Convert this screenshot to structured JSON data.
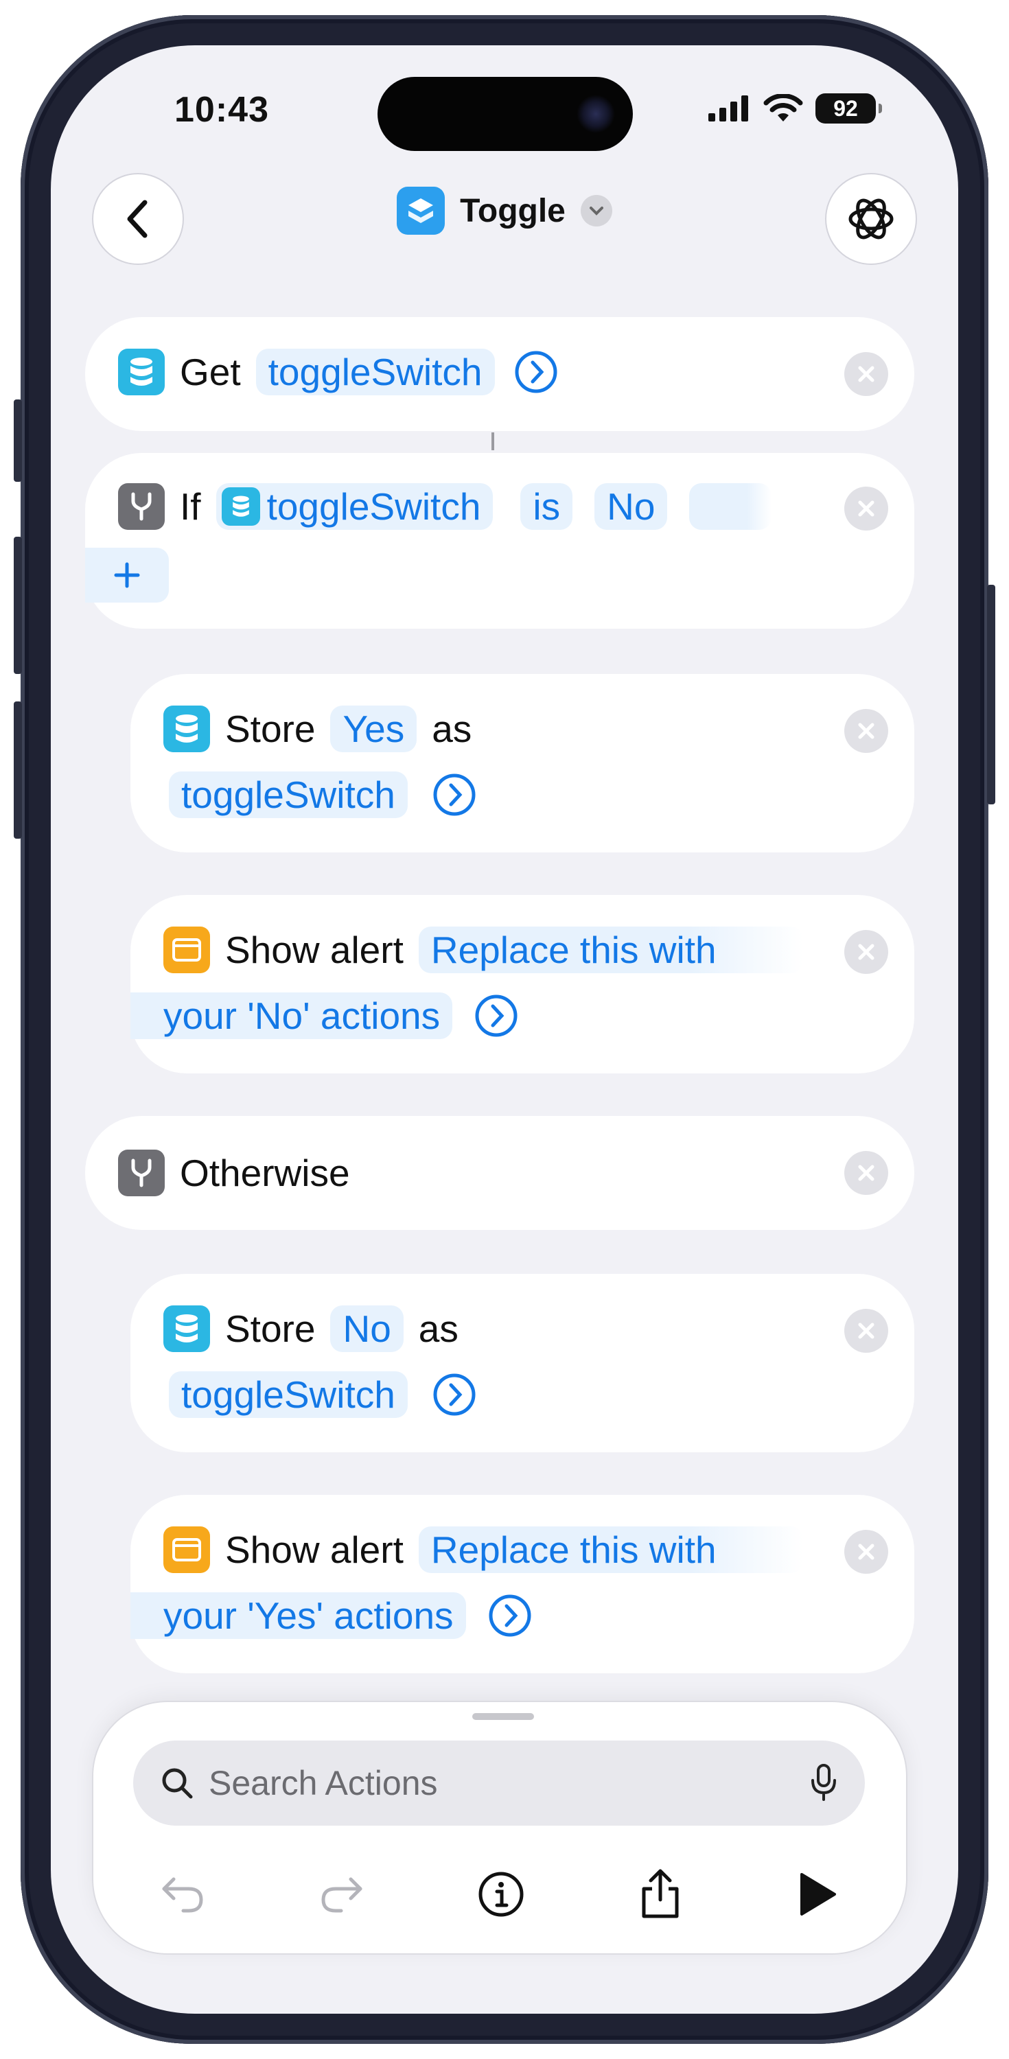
{
  "status_bar": {
    "time": "10:43",
    "battery": "92"
  },
  "header": {
    "title": "Toggle"
  },
  "actions": {
    "get": {
      "verb": "Get",
      "var": "toggleSwitch"
    },
    "if_block": {
      "verb": "If",
      "var": "toggleSwitch",
      "op": "is",
      "value": "No"
    },
    "store_yes": {
      "verb": "Store",
      "value": "Yes",
      "as": "as",
      "var": "toggleSwitch"
    },
    "alert_no": {
      "verb": "Show alert",
      "line1": "Replace this with",
      "line2": "your 'No' actions"
    },
    "otherwise": {
      "label": "Otherwise"
    },
    "store_no": {
      "verb": "Store",
      "value": "No",
      "as": "as",
      "var": "toggleSwitch"
    },
    "alert_yes": {
      "verb": "Show alert",
      "line1": "Replace this with",
      "line2": "your 'Yes' actions"
    }
  },
  "search": {
    "placeholder": "Search Actions"
  },
  "colors": {
    "accent": "#1378e6",
    "token_bg": "#e7f2fd",
    "variable_icon": "#2bb7e3",
    "alert_icon": "#f7a81b"
  }
}
